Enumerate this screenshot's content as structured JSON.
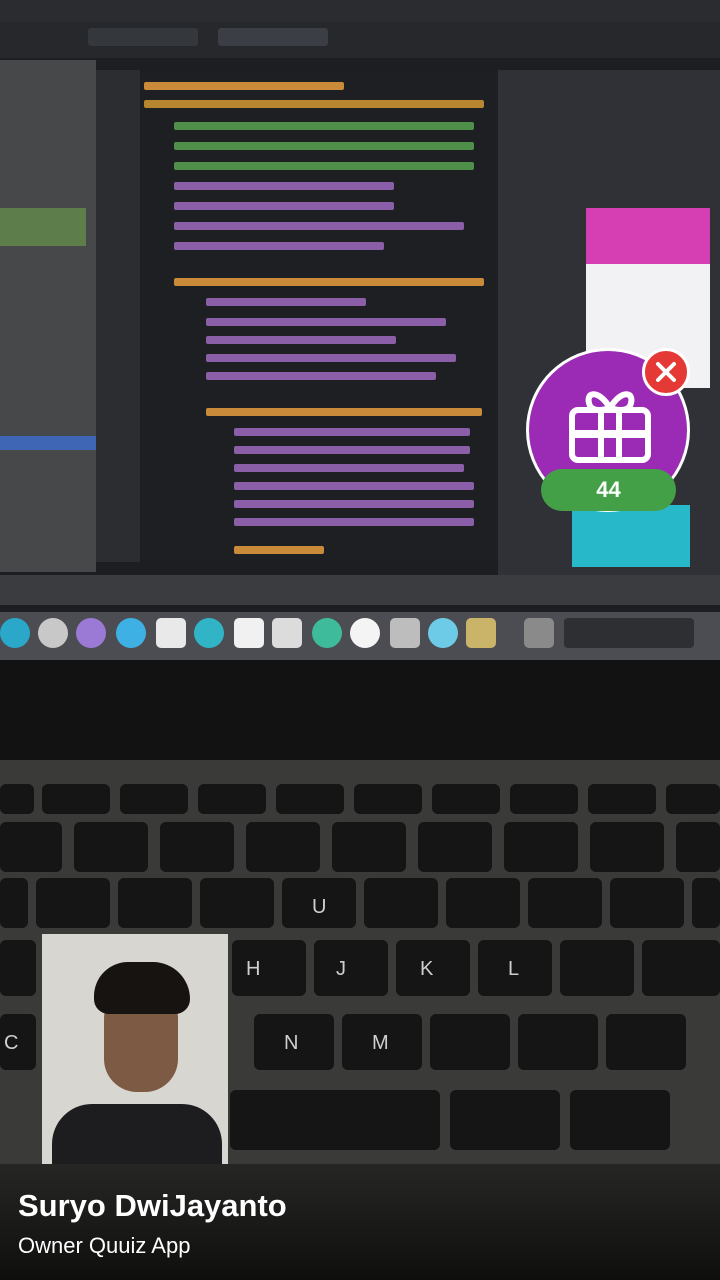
{
  "gift": {
    "count": "44",
    "icon": "gift-box-icon",
    "close_icon": "close-icon",
    "colors": {
      "circle": "#9b2bb5",
      "badge": "#43a047",
      "close": "#e53935"
    }
  },
  "caption": {
    "name": "Suryo DwiJayanto",
    "subtitle": "Owner Quuiz App"
  }
}
